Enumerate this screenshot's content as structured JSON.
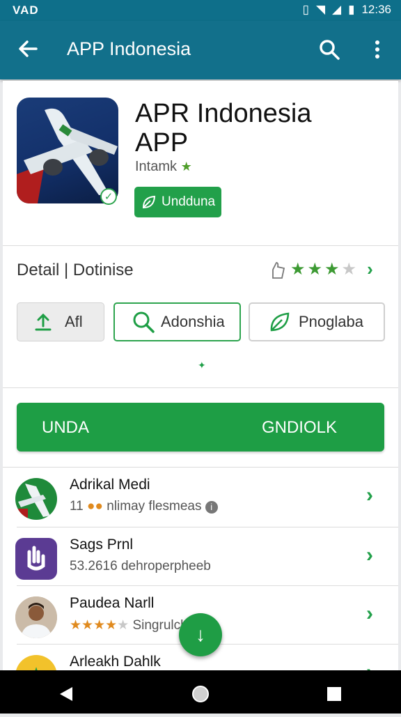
{
  "status_bar": {
    "left": "VAD",
    "time": "12:36"
  },
  "app_bar": {
    "title": "APP Indonesia"
  },
  "hero": {
    "title_line1": "APR Indonesia",
    "title_line2": "APP",
    "subtitle": "Intamk",
    "install_label": "Undduna"
  },
  "detail_row": {
    "label": "Detail | Dotinise",
    "rating_stars": 3,
    "rating_max": 4
  },
  "chips": [
    {
      "label": "Afl",
      "icon": "upload-icon"
    },
    {
      "label": "Adonshia",
      "icon": "search-icon"
    },
    {
      "label": "Pnoglaba",
      "icon": "leaf-icon"
    }
  ],
  "cta": {
    "left_label": "UNDA",
    "right_label": "GNDIOLK"
  },
  "list": [
    {
      "title": "Adrikal Medi",
      "subtitle": "11",
      "subtitle_tail": "nlimay flesmeas",
      "avatar": "airplane-avatar"
    },
    {
      "title": "Sags Prnl",
      "subtitle": "53.2616 dehroperpheeb",
      "avatar": "hand-app-icon"
    },
    {
      "title": "Paudea Narll",
      "subtitle": "Singrulcl",
      "stars": 4,
      "avatar": "person-photo"
    },
    {
      "title": "Arleakh Dahlk",
      "subtitle": "",
      "avatar": "star-avatar"
    }
  ],
  "colors": {
    "primary": "#12708b",
    "accent": "#1e9e45"
  }
}
